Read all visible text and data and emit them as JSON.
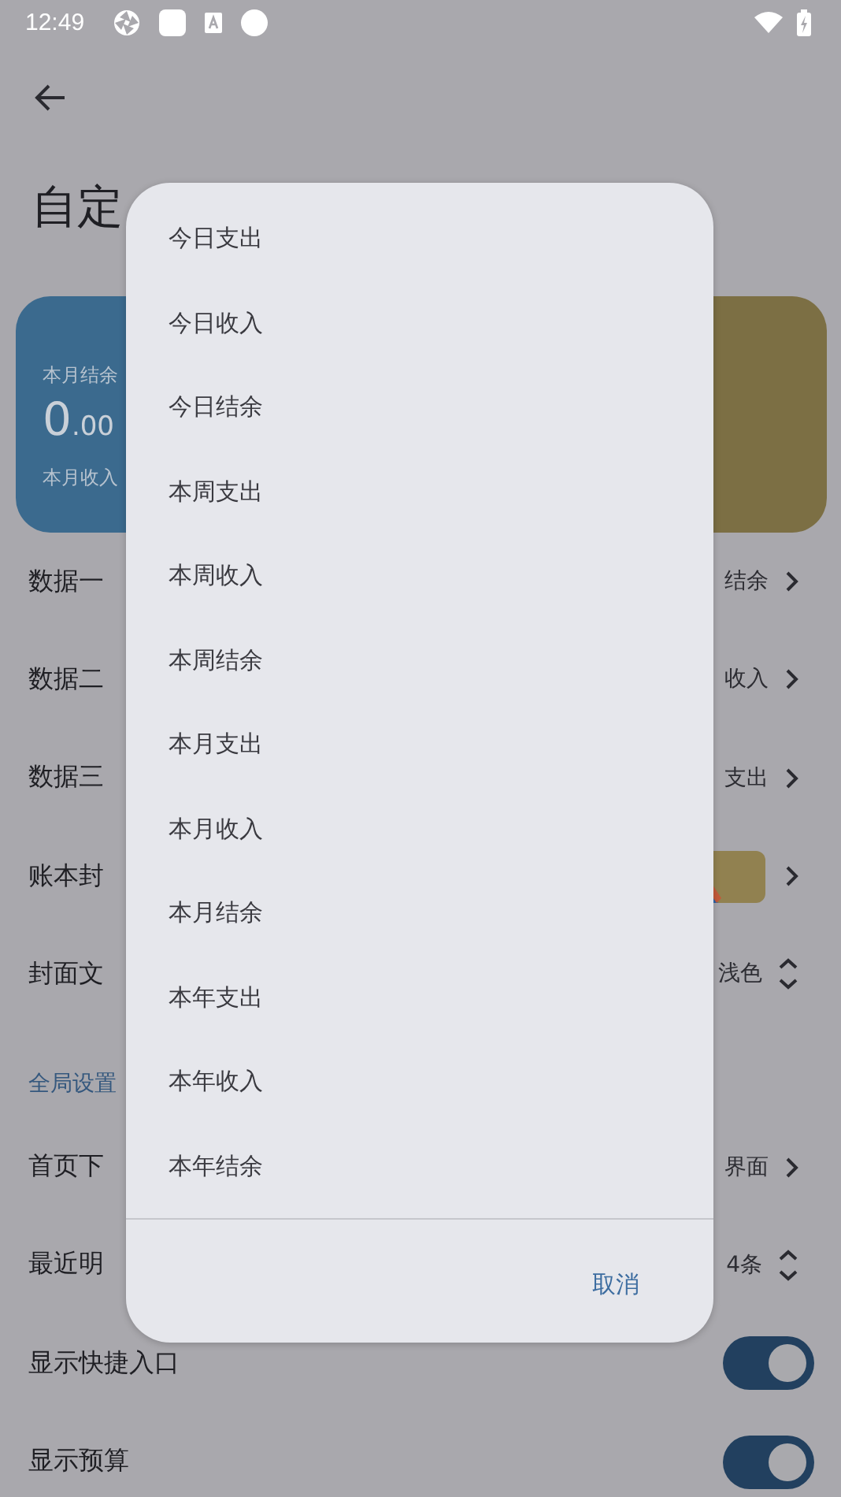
{
  "status_bar": {
    "time": "12:49"
  },
  "page": {
    "title": "自定",
    "card": {
      "label": "本月结余",
      "amount_int": "0",
      "amount_dec": ".00",
      "footer": "本月收入"
    },
    "rows": [
      {
        "kind": "select",
        "label": "数据一",
        "value": "结余"
      },
      {
        "kind": "select",
        "label": "数据二",
        "value": "收入"
      },
      {
        "kind": "select",
        "label": "数据三",
        "value": "支出"
      },
      {
        "kind": "cover",
        "label": "账本封"
      },
      {
        "kind": "spinner",
        "label": "封面文",
        "value": "浅色"
      },
      {
        "kind": "header",
        "label": "全局设置"
      },
      {
        "kind": "select",
        "label": "首页下",
        "value": "界面"
      },
      {
        "kind": "spinner",
        "label": "最近明",
        "value": "4条"
      },
      {
        "kind": "toggle",
        "label": "显示快捷入口",
        "on": true
      },
      {
        "kind": "toggle",
        "label": "显示预算",
        "on": true
      }
    ]
  },
  "dialog": {
    "options": [
      "今日支出",
      "今日收入",
      "今日结余",
      "本周支出",
      "本周收入",
      "本周结余",
      "本月支出",
      "本月收入",
      "本月结余",
      "本年支出",
      "本年收入",
      "本年结余"
    ],
    "buttons": [
      "取消"
    ]
  }
}
